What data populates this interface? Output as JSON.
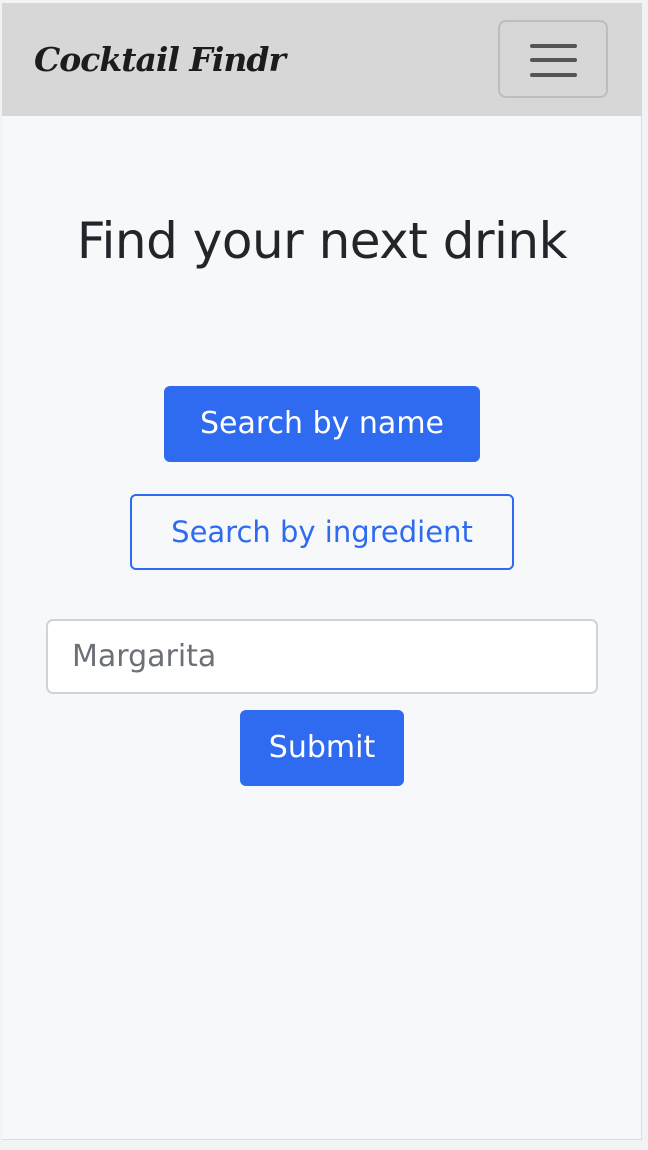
{
  "navbar": {
    "brand": "Cocktail Findr",
    "toggler_icon": "hamburger-menu-icon"
  },
  "main": {
    "heading": "Find your next drink",
    "search_by_name_label": "Search by name",
    "search_by_ingredient_label": "Search by ingredient",
    "search_input": {
      "value": "",
      "placeholder": "Margarita"
    },
    "submit_label": "Submit"
  },
  "colors": {
    "navbar_bg": "#d7d7d7",
    "primary": "#2f6bf0",
    "page_bg": "#f7f8fa",
    "text": "#22252a"
  }
}
